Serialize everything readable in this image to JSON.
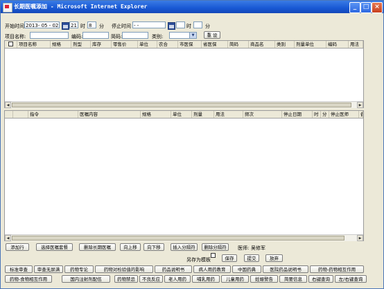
{
  "window": {
    "title": "长期医嘱添加 - Microsoft Internet Explorer"
  },
  "form": {
    "start_time_label": "开始时间",
    "start_date": "2013- 05 - 02",
    "start_hour": "21",
    "hour_label": "时",
    "start_minute": "8",
    "minute_label": "分",
    "stop_time_label": "停止时间",
    "stop_date": "   -     -",
    "stop_hour": "",
    "stop_minute": "",
    "item_name_label": "项目名称:",
    "code_label": "编码:",
    "short_code_label": "简码:",
    "category_label": "类别:",
    "category_value": "",
    "reset_label": "重 设"
  },
  "upper_grid": {
    "columns": [
      "项目名称",
      "规格",
      "剂型",
      "库存",
      "零售价",
      "单位",
      "农合",
      "市医保",
      "省医保",
      "简码",
      "商品名",
      "类别",
      "剂量单位",
      "编码",
      "用法"
    ]
  },
  "lower_grid": {
    "columns": [
      "指令",
      "医嘱内容",
      "规格",
      "单位",
      "剂量",
      "用法",
      "频次",
      "停止日期",
      "时",
      "分",
      "停止医师",
      "备"
    ]
  },
  "actions": {
    "add_row": "添加行",
    "select_template": "选择医嘱套餐",
    "delete_order": "删除长期医嘱",
    "move_up": "向上移",
    "move_down": "向下移",
    "insert_separator": "插入分隔符",
    "delete_separator": "删除分隔符",
    "doctor_label": "医师:",
    "doctor_name": "吴修军",
    "save_as_template": "另存为模板",
    "save": "保存",
    "submit": "提交",
    "discard": "放弃"
  },
  "bottom_row1": [
    "标准审查",
    "审查无屏满",
    "药物专论",
    "药物对检验值的影响",
    "药品说明书",
    "病人用药教育",
    "中国药典",
    "医院药品说明书",
    "药物-药物相互作用"
  ],
  "bottom_row2": [
    "药物-食物相互作用",
    "国内注射剂配伍",
    "药物禁忌",
    "不良反应",
    "老人用药",
    "哺乳用药",
    "儿童用药",
    "妊娠警告",
    "简要信息",
    "右键查询",
    "左/右键查询"
  ]
}
